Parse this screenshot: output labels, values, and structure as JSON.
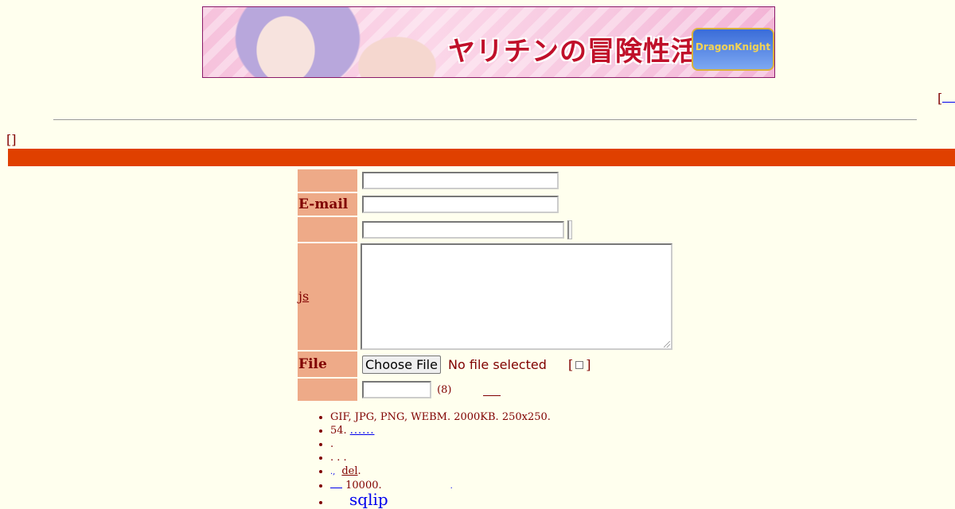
{
  "banner": {
    "title": "ヤリチンの冒険性活",
    "logo_text": "DragonKnight V"
  },
  "top_link_fragment": "[",
  "brackets": "[]",
  "form": {
    "email_label": "E-mail",
    "comment_label": "js",
    "file_label": "File",
    "file_button": "Choose File",
    "file_status": "No file selected",
    "textonly_open": "[",
    "textonly_close": "]",
    "password_note": "(8)"
  },
  "rules": {
    "r1": "GIF, JPG, PNG, WEBM. 2000KB. 250x250.",
    "r2": "54.",
    "r2_link": "......",
    "r3": ".",
    "r4": ". . .",
    "r5_link": ".,",
    "r5_del": "del",
    "r5_end": ".",
    "r6": "10000.",
    "r6_tail": ".",
    "r7_link": "sqlip"
  }
}
